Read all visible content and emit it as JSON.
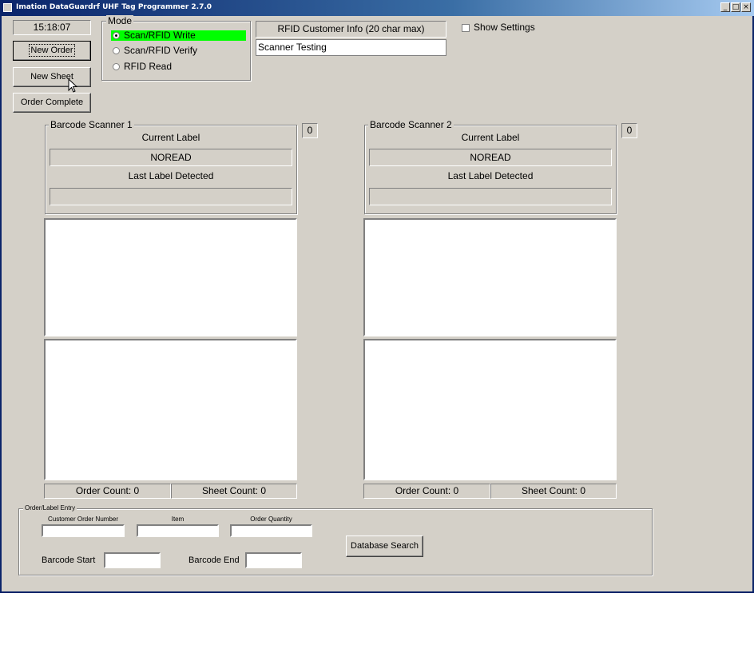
{
  "window": {
    "title": "Imation DataGuardrf UHF Tag Programmer 2.7.0"
  },
  "clock": "15:18:07",
  "buttons": {
    "new_order": "New Order",
    "new_sheet": "New Sheet",
    "order_complete": "Order Complete",
    "database_search": "Database Search"
  },
  "mode": {
    "legend": "Mode",
    "options": [
      "Scan/RFID Write",
      "Scan/RFID Verify",
      "RFID Read"
    ],
    "selected": "Scan/RFID Write",
    "highlight_color": "#00ff00"
  },
  "rfid_customer_info": {
    "label": "RFID Customer Info (20 char max)",
    "value": "Scanner Testing"
  },
  "show_settings": {
    "label": "Show Settings",
    "checked": false
  },
  "scanners": [
    {
      "legend": "Barcode Scanner 1",
      "counter": "0",
      "current_label_title": "Current Label",
      "current_label_value": "NOREAD",
      "last_label_title": "Last Label Detected",
      "last_label_value": "",
      "order_count": "Order Count: 0",
      "sheet_count": "Sheet Count: 0"
    },
    {
      "legend": "Barcode Scanner 2",
      "counter": "0",
      "current_label_title": "Current Label",
      "current_label_value": "NOREAD",
      "last_label_title": "Last Label Detected",
      "last_label_value": "",
      "order_count": "Order Count: 0",
      "sheet_count": "Sheet Count: 0"
    }
  ],
  "order_entry": {
    "legend": "Order/Label Entry",
    "customer_order_number_label": "Customer Order Number",
    "item_label": "Item",
    "order_quantity_label": "Order Quantity",
    "barcode_start_label": "Barcode Start",
    "barcode_end_label": "Barcode End",
    "customer_order_number": "",
    "item": "",
    "order_quantity": "",
    "barcode_start": "",
    "barcode_end": ""
  }
}
